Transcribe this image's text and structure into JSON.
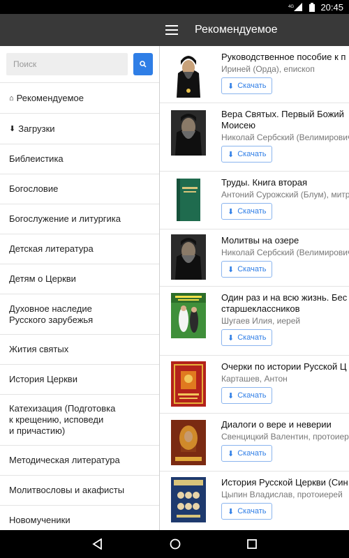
{
  "status": {
    "signal_label": "4G",
    "time": "20:45"
  },
  "toolbar": {
    "title": "Рекомендуемое"
  },
  "search": {
    "placeholder": "Поиск"
  },
  "nav": [
    {
      "label": "Рекомендуемое",
      "icon": "home-icon"
    },
    {
      "label": "Загрузки",
      "icon": "download-icon"
    },
    {
      "label": "Библеистика"
    },
    {
      "label": "Богословие"
    },
    {
      "label": "Богослужение и литургика"
    },
    {
      "label": "Детская литература"
    },
    {
      "label": "Детям о Церкви"
    },
    {
      "label": "Духовное наследие\nРусского зарубежья"
    },
    {
      "label": "Жития святых"
    },
    {
      "label": "История Церкви"
    },
    {
      "label": "Катехизация (Подготовка\nк крещению, исповеди\nи причастию)"
    },
    {
      "label": "Методическая литература"
    },
    {
      "label": "Молитвословы и акафисты"
    },
    {
      "label": "Новомученики"
    }
  ],
  "books": [
    {
      "title": "Руководственное пособие к п",
      "author": "Ириней (Орда), епископ",
      "download_label": "Скачать"
    },
    {
      "title": "Вера Святых. Первый Божий\nМоисею",
      "author": "Николай Сербский (Велимирович",
      "download_label": "Скачать"
    },
    {
      "title": "Труды. Книга вторая",
      "author": "Антоний Сурожский (Блум), митр",
      "download_label": "Скачать"
    },
    {
      "title": "Молитвы на озере",
      "author": "Николай Сербский (Велимирович",
      "download_label": "Скачать"
    },
    {
      "title": "Один раз и на всю жизнь. Бес\nстаршеклассников",
      "author": "Шугаев Илия, иерей",
      "download_label": "Скачать"
    },
    {
      "title": "Очерки по истории Русской Ц",
      "author": "Карташев, Антон",
      "download_label": "Скачать"
    },
    {
      "title": "Диалоги о вере и неверии",
      "author": "Свенцицкий Валентин, протоиерей",
      "download_label": "Скачать"
    },
    {
      "title": "История Русской Церкви (Син",
      "author": "Цыпин Владислав, протоиерей",
      "download_label": "Скачать"
    }
  ],
  "colors": {
    "toolbar": "#393939",
    "accent": "#2f7ee6"
  }
}
